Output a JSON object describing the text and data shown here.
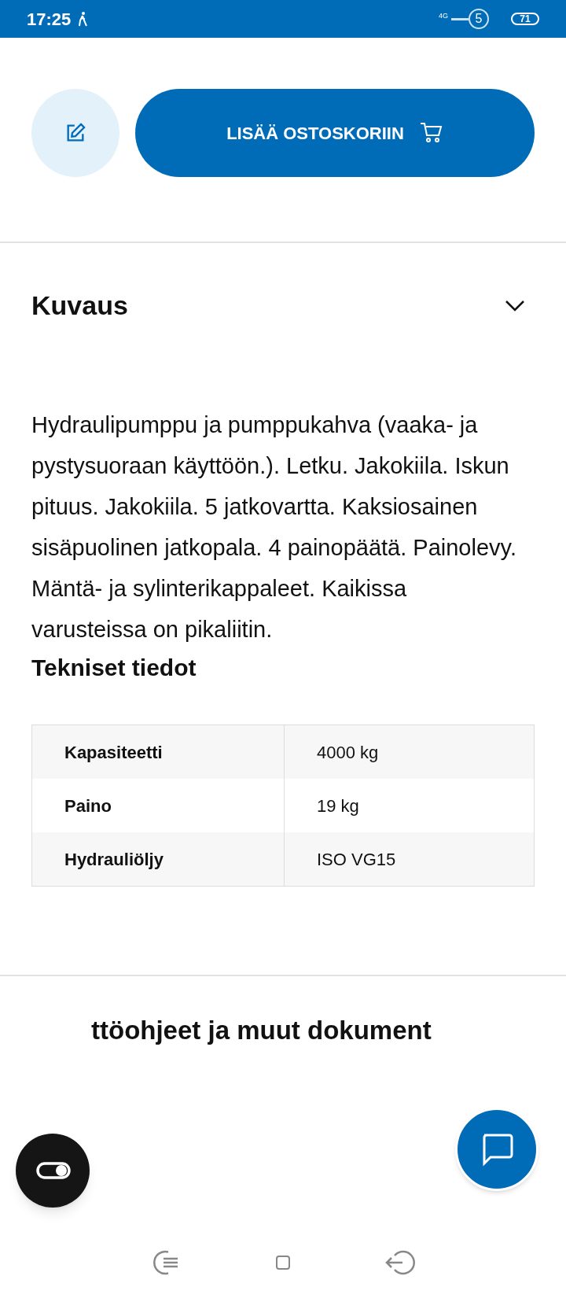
{
  "status_bar": {
    "time": "17:25",
    "network": "4G",
    "sim": "5",
    "battery": "71"
  },
  "actions": {
    "cart_button": "LISÄÄ OSTOSKORIIN"
  },
  "description": {
    "title": "Kuvaus",
    "expanded": true,
    "text": "Hydraulipumppu ja pumppukahva (vaaka- ja pystysuoraan käyttöön.). Letku. Jakokiila. Iskun pituus. Jakokiila. 5 jatkovartta. Kaksiosainen sisäpuolinen jatkopala. 4 painopäätä. Painolevy. Mäntä- ja sylinterikappaleet. Kaikissa varusteissa on pikaliitin."
  },
  "specs": {
    "title": "Tekniset tiedot",
    "rows": [
      {
        "label": "Kapasiteetti",
        "value": "4000 kg"
      },
      {
        "label": "Paino",
        "value": "19 kg"
      },
      {
        "label": "Hydrauliöljy",
        "value": "ISO VG15"
      }
    ]
  },
  "documents": {
    "title": "ttöohjeet ja muut dokument"
  }
}
